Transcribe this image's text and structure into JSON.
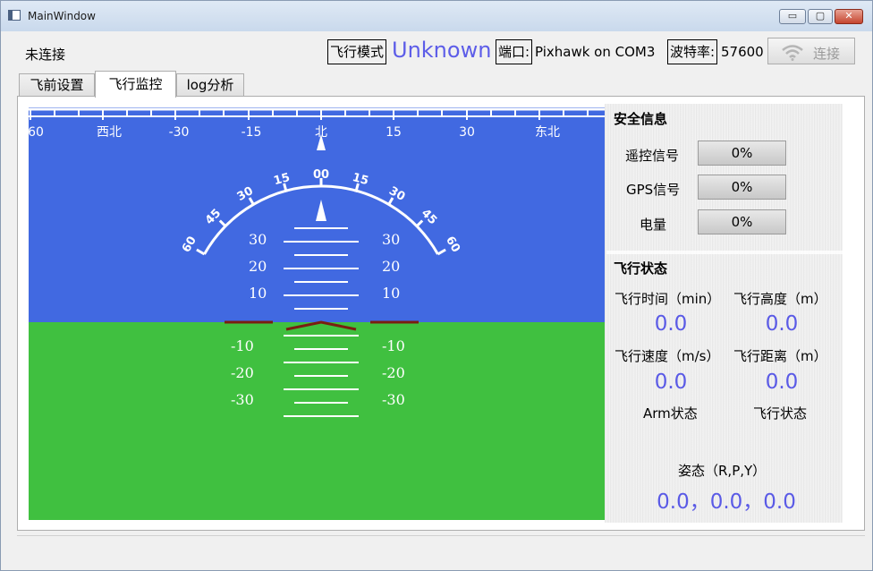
{
  "window": {
    "title": "MainWindow",
    "min_glyph": "▭",
    "max_glyph": "▢",
    "close_glyph": "✕"
  },
  "header": {
    "connection_status": "未连接",
    "mode_label": "飞行模式",
    "mode_value": "Unknown",
    "port_label": "端口:",
    "port_value": "Pixhawk on COM3",
    "baud_label": "波特率:",
    "baud_value": "57600",
    "connect_label": "连接",
    "connect_icon": "wifi-icon"
  },
  "tabs": [
    {
      "label": "飞前设置"
    },
    {
      "label": "飞行监控"
    },
    {
      "label": "log分析"
    }
  ],
  "active_tab": 1,
  "hud": {
    "sky_color": "#4169e1",
    "ground_color": "#40c040",
    "heading_labels": [
      "60",
      "西北",
      "-30",
      "-15",
      "北",
      "15",
      "30",
      "东北"
    ],
    "bank_labels": [
      "60",
      "45",
      "30",
      "15",
      "00",
      "15",
      "30",
      "45",
      "60"
    ],
    "pitch_up": [
      "30",
      "20",
      "10"
    ],
    "pitch_down": [
      "-10",
      "-20",
      "-30"
    ]
  },
  "safety": {
    "title": "安全信息",
    "rc_label": "遥控信号",
    "rc_value": "0%",
    "gps_label": "GPS信号",
    "gps_value": "0%",
    "battery_label": "电量",
    "battery_value": "0%"
  },
  "flight_status": {
    "title": "飞行状态",
    "time_label": "飞行时间（min）",
    "time_value": "0.0",
    "alt_label": "飞行高度（m）",
    "alt_value": "0.0",
    "speed_label": "飞行速度（m/s）",
    "speed_value": "0.0",
    "dist_label": "飞行距离（m）",
    "dist_value": "0.0",
    "arm_label": "Arm状态",
    "state_label": "飞行状态",
    "attitude_label": "姿态（R,P,Y）",
    "attitude_value": "0.0，0.0，0.0"
  }
}
